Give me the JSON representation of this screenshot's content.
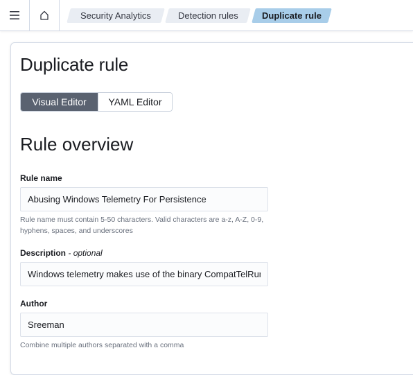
{
  "header": {
    "menu_icon": "hamburger-menu-icon",
    "home_icon": "home-icon",
    "breadcrumbs": [
      {
        "label": "Security Analytics"
      },
      {
        "label": "Detection rules"
      },
      {
        "label": "Duplicate rule"
      }
    ],
    "colors": {
      "active_crumb": "#a8cde9",
      "crumb": "#e9edf3"
    }
  },
  "page": {
    "title": "Duplicate rule",
    "editor_toggle": {
      "visual_label": "Visual Editor",
      "yaml_label": "YAML Editor",
      "selected": "Visual Editor"
    },
    "section_title": "Rule overview"
  },
  "form": {
    "rule_name": {
      "label": "Rule name",
      "value": "Abusing Windows Telemetry For Persistence",
      "help": "Rule name must contain 5-50 characters. Valid characters are a-z, A-Z, 0-9, hyphens, spaces, and underscores"
    },
    "description": {
      "label": "Description",
      "optional": "- optional",
      "value": "Windows telemetry makes use of the binary CompatTelRunner.exe"
    },
    "author": {
      "label": "Author",
      "value": "Sreeman",
      "help": "Combine multiple authors separated with a comma"
    }
  }
}
